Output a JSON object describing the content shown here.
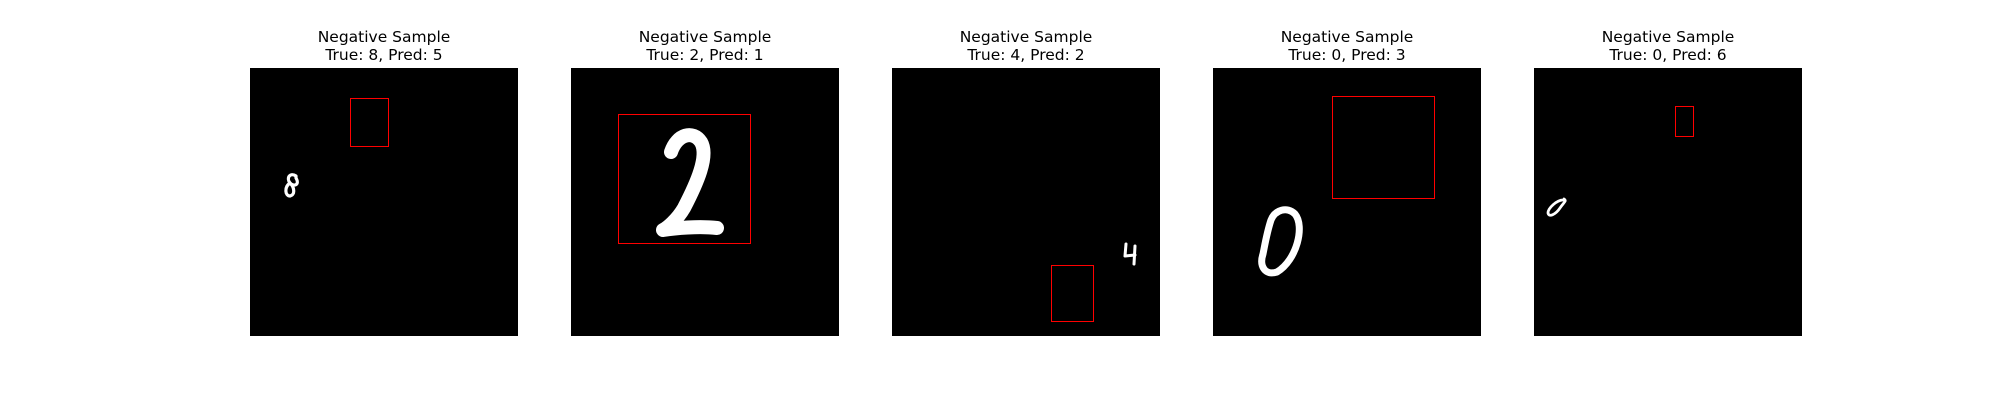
{
  "figure": {
    "background": "#ffffff",
    "image_background": "#000000",
    "box_color": "#ff0000",
    "digit_color": "#ffffff"
  },
  "panels": [
    {
      "heading": "Negative Sample",
      "caption": "True: 8, Pred: 5",
      "true_label": "8",
      "pred_label": "5"
    },
    {
      "heading": "Negative Sample",
      "caption": "True: 2, Pred: 1",
      "true_label": "2",
      "pred_label": "1"
    },
    {
      "heading": "Negative Sample",
      "caption": "True: 4, Pred: 2",
      "true_label": "4",
      "pred_label": "2"
    },
    {
      "heading": "Negative Sample",
      "caption": "True: 0, Pred: 3",
      "true_label": "0",
      "pred_label": "3"
    },
    {
      "heading": "Negative Sample",
      "caption": "True: 0, Pred: 6",
      "true_label": "0",
      "pred_label": "6"
    }
  ]
}
